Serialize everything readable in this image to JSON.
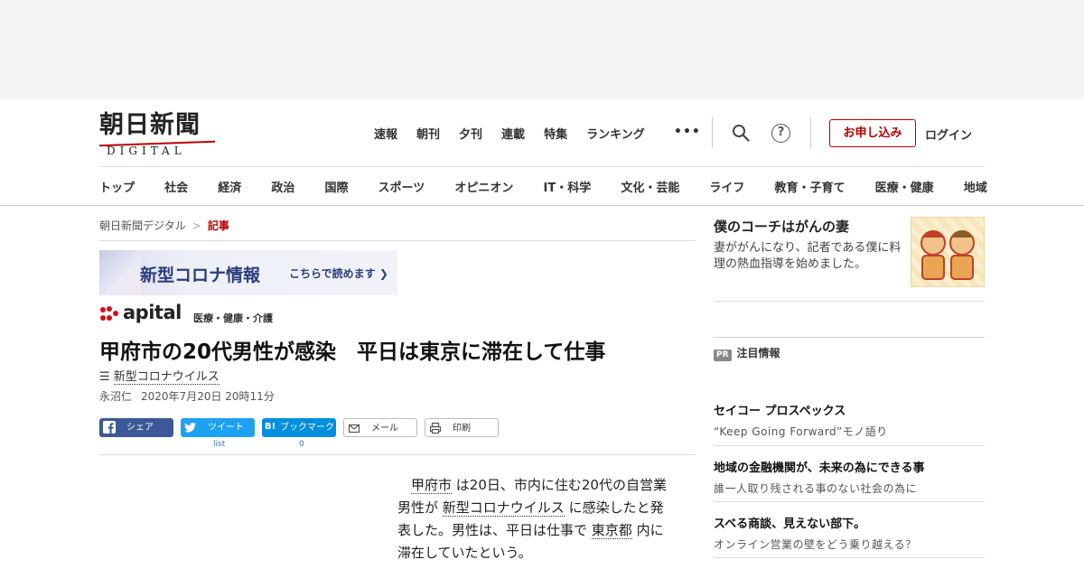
{
  "header": {
    "logo_jp": "朝日新聞",
    "logo_en": "DIGITAL",
    "top_nav": [
      "速報",
      "朝刊",
      "夕刊",
      "連載",
      "特集",
      "ランキング"
    ],
    "more": "•••",
    "help": "?",
    "signup": "お申し込み",
    "login": "ログイン"
  },
  "category_nav": [
    "トップ",
    "社会",
    "経済",
    "政治",
    "国際",
    "スポーツ",
    "オピニオン",
    "IT・科学",
    "文化・芸能",
    "ライフ",
    "教育・子育て",
    "医療・健康",
    "地域"
  ],
  "breadcrumb": {
    "home": "朝日新聞デジタル",
    "sep": ">",
    "current": "記事"
  },
  "banner": {
    "title": "新型コロナ情報",
    "cta": "こちらで読めます ❯"
  },
  "apital": {
    "brand": "apital",
    "tag": "医療・健康・介護"
  },
  "article": {
    "headline": "甲府市の20代男性が感染　平日は東京に滞在して仕事",
    "topic": "新型コロナウイルス",
    "author": "永沼仁",
    "date": "2020年7月20日 20時11分",
    "body_parts": [
      "甲府市",
      " は20日、市内に住む20代の自営業男性が ",
      "新型コロナウイルス",
      " に感染したと発表した。男性は、平日は仕事で ",
      "東京都",
      " 内に滞在していたという。"
    ]
  },
  "share": {
    "facebook": "シェア",
    "twitter": "ツイート",
    "hatena_icon": "B!",
    "hatena": "ブックマーク",
    "mail": "メール",
    "print": "印刷",
    "twitter_count": "list",
    "hatena_count": "0"
  },
  "sidebar": {
    "feature": {
      "title": "僕のコーチはがんの妻",
      "desc": "妻ががんになり、記者である僕に料理の熱血指導を始めました。"
    },
    "pr_badge": "PR",
    "pr_heading": "注目情報",
    "pr_items": [
      {
        "title": "セイコー プロスペックス",
        "sub": "“Keep Going Forward”モノ語り"
      },
      {
        "title": "地域の金融機関が、未来の為にできる事",
        "sub": "誰一人取り残される事のない社会の為に"
      },
      {
        "title": "スベる商談、見えない部下。",
        "sub": "オンライン営業の壁をどう乗り越える？"
      }
    ]
  }
}
